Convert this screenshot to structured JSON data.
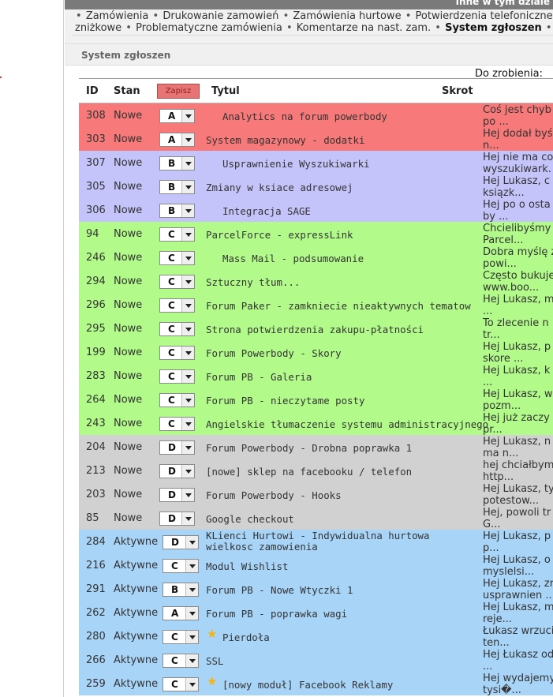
{
  "header": {
    "title": "Inne w tym dziale"
  },
  "menu": {
    "line1": [
      "Zamówienia",
      "Drukowanie zamowień",
      "Zamówienia hurtowe",
      "Potwierdzenia telefoniczne"
    ],
    "line2": [
      "zniżkowe",
      "Problematyczne zamówienia",
      "Komentarze na nast. zam.",
      "System zgłoszen",
      "N"
    ],
    "active": "System zgłoszen",
    "separator": "•"
  },
  "panel": {
    "title": "System zgłoszen",
    "todo_label": "Do zrobienia:"
  },
  "table": {
    "columns": {
      "id": "ID",
      "stan": "Stan",
      "save": "Zapisz",
      "title": "Tytul",
      "skrot": "Skrot"
    },
    "colors": {
      "A": "#f87979",
      "B": "#c4c4fb",
      "C": "#b2fb8a",
      "D": "#d1d1d1",
      "aktywne": "#a8d4f7"
    },
    "rows": [
      {
        "id": "308",
        "stan": "Nowe",
        "priority": "A",
        "title": "Analytics na forum powerbody",
        "skrot": "Coś jest chyb\npo ...",
        "indent": true
      },
      {
        "id": "303",
        "stan": "Nowe",
        "priority": "A",
        "title": "System magazynowy - dodatki",
        "skrot": "Hej dodał byś\nn..."
      },
      {
        "id": "307",
        "stan": "Nowe",
        "priority": "B",
        "title": "Usprawnienie Wyszukiwarki",
        "skrot": "Hej nie ma co\nwyszukiwark.",
        "indent": true
      },
      {
        "id": "305",
        "stan": "Nowe",
        "priority": "B",
        "title": "Zmiany w ksiace adresowej",
        "skrot": "Hej Lukasz, c\nksiązk..."
      },
      {
        "id": "306",
        "stan": "Nowe",
        "priority": "B",
        "title": "Integracja SAGE",
        "skrot": "Hej po o osta\nby ...",
        "indent": true
      },
      {
        "id": "94",
        "stan": "Nowe",
        "priority": "C",
        "title": "ParcelForce - expressLink",
        "skrot": "Chcielibyśmy\nParcel..."
      },
      {
        "id": "246",
        "stan": "Nowe",
        "priority": "C",
        "title": "Mass Mail - podsumowanie",
        "skrot": "Dobra myślę ż\npowi...",
        "indent": true
      },
      {
        "id": "294",
        "stan": "Nowe",
        "priority": "C",
        "title": "Sztuczny tłum...",
        "skrot": "Często bukuje\nwww.boo..."
      },
      {
        "id": "296",
        "stan": "Nowe",
        "priority": "C",
        "title": "Forum Paker - zamkniecie nieaktywnych tematow",
        "skrot": "Hej Lukasz, m\n..."
      },
      {
        "id": "295",
        "stan": "Nowe",
        "priority": "C",
        "title": "Strona potwierdzenia zakupu-płatności",
        "skrot": "To zlecenie n\ntr..."
      },
      {
        "id": "199",
        "stan": "Nowe",
        "priority": "C",
        "title": "Forum Powerbody - Skory",
        "skrot": "Hej Lukasz, p\nskore ..."
      },
      {
        "id": "283",
        "stan": "Nowe",
        "priority": "C",
        "title": "Forum PB - Galeria",
        "skrot": "Hej Lukasz, k\n..."
      },
      {
        "id": "264",
        "stan": "Nowe",
        "priority": "C",
        "title": "Forum PB - nieczytame posty",
        "skrot": "Hej Lukasz, w\npozm..."
      },
      {
        "id": "243",
        "stan": "Nowe",
        "priority": "C",
        "title": "Angielskie tłumaczenie systemu administracyjnego",
        "skrot": "Hej już zaczy\npr..."
      },
      {
        "id": "204",
        "stan": "Nowe",
        "priority": "D",
        "title": "Forum Powerbody - Drobna poprawka 1",
        "skrot": "Hej Lukasz, n\nma n..."
      },
      {
        "id": "213",
        "stan": "Nowe",
        "priority": "D",
        "title": "[nowe] sklep na facebooku / telefon",
        "skrot": "hej chciałbym\nhttp..."
      },
      {
        "id": "203",
        "stan": "Nowe",
        "priority": "D",
        "title": "Forum Powerbody - Hooks",
        "skrot": "Hej Lukasz, ty\npotestow..."
      },
      {
        "id": "85",
        "stan": "Nowe",
        "priority": "D",
        "title": "Google checkout",
        "skrot": "Hej, powoli tr\nG..."
      },
      {
        "id": "284",
        "stan": "Aktywne",
        "priority": "D",
        "title": "KLienci Hurtowi - Indywidualna hurtowa wielkosc zamowienia",
        "skrot": "Hej Lukasz, p\np...",
        "two_line": true
      },
      {
        "id": "216",
        "stan": "Aktywne",
        "priority": "C",
        "title": "Modul Wishlist",
        "skrot": "Hej Lukasz, o\nmyslelsi..."
      },
      {
        "id": "291",
        "stan": "Aktywne",
        "priority": "B",
        "title": "Forum PB - Nowe Wtyczki 1",
        "skrot": "Hej Lukasz, zr\nusprawnien ..."
      },
      {
        "id": "262",
        "stan": "Aktywne",
        "priority": "A",
        "title": "Forum PB - poprawka wagi",
        "skrot": "Hej Lukasz, m\nreje..."
      },
      {
        "id": "280",
        "stan": "Aktywne",
        "priority": "C",
        "title": "Pierdoła",
        "skrot": "Łukasz wrzuci\nten...",
        "star": true
      },
      {
        "id": "266",
        "stan": "Aktywne",
        "priority": "C",
        "title": "SSL",
        "skrot": "Hej Łukasz od\n..."
      },
      {
        "id": "259",
        "stan": "Aktywne",
        "priority": "C",
        "title": "[nowy moduł] Facebook Reklamy",
        "skrot": "Hej wydajemy\ntysi�...",
        "star": true
      }
    ]
  }
}
